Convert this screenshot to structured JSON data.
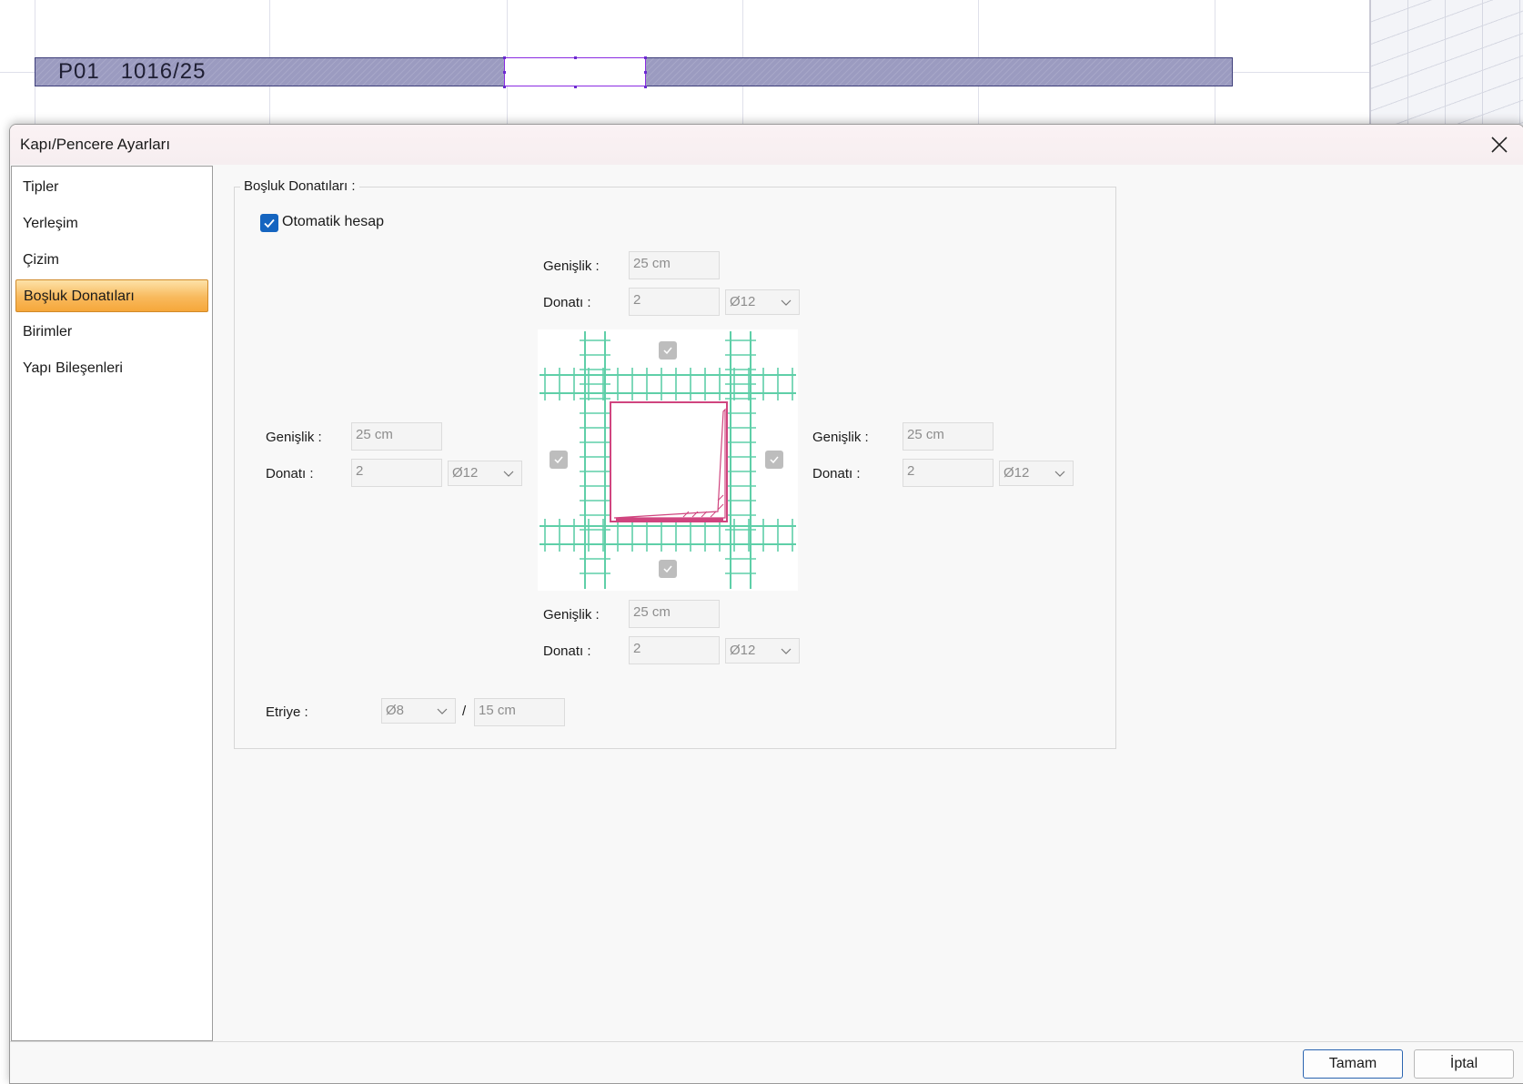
{
  "cad": {
    "wall_label": "P01   1016/25"
  },
  "dialog": {
    "title": "Kapı/Pencere Ayarları",
    "close_label": "✕"
  },
  "nav": {
    "items": [
      {
        "label": "Tipler"
      },
      {
        "label": "Yerleşim"
      },
      {
        "label": "Çizim"
      },
      {
        "label": "Boşluk Donatıları",
        "active": true
      },
      {
        "label": "Birimler"
      },
      {
        "label": "Yapı Bileşenleri"
      }
    ]
  },
  "reinforcement": {
    "group_title": "Boşluk Donatıları :",
    "auto_calc": {
      "label": "Otomatik hesap",
      "checked": true
    },
    "top": {
      "width_label": "Genişlik :",
      "width_value": "25 cm",
      "bar_label": "Donatı :",
      "bar_count": "2",
      "bar_dia": "Ø12",
      "enabled": true
    },
    "left": {
      "width_label": "Genişlik :",
      "width_value": "25 cm",
      "bar_label": "Donatı :",
      "bar_count": "2",
      "bar_dia": "Ø12",
      "enabled": true
    },
    "right": {
      "width_label": "Genişlik :",
      "width_value": "25 cm",
      "bar_label": "Donatı :",
      "bar_count": "2",
      "bar_dia": "Ø12",
      "enabled": true
    },
    "bottom": {
      "width_label": "Genişlik :",
      "width_value": "25 cm",
      "bar_label": "Donatı :",
      "bar_count": "2",
      "bar_dia": "Ø12",
      "enabled": true
    },
    "stirrup": {
      "label": "Etriye :",
      "dia": "Ø8",
      "separator": "/",
      "spacing": "15 cm"
    }
  },
  "buttons": {
    "ok": "Tamam",
    "cancel": "İptal"
  },
  "colors": {
    "rebar": "#5fcfa8",
    "opening_outline": "#d0457f",
    "accent": "#1565c0",
    "active_nav": "#f6a73a",
    "wall_fill": "#9b9bc0"
  }
}
